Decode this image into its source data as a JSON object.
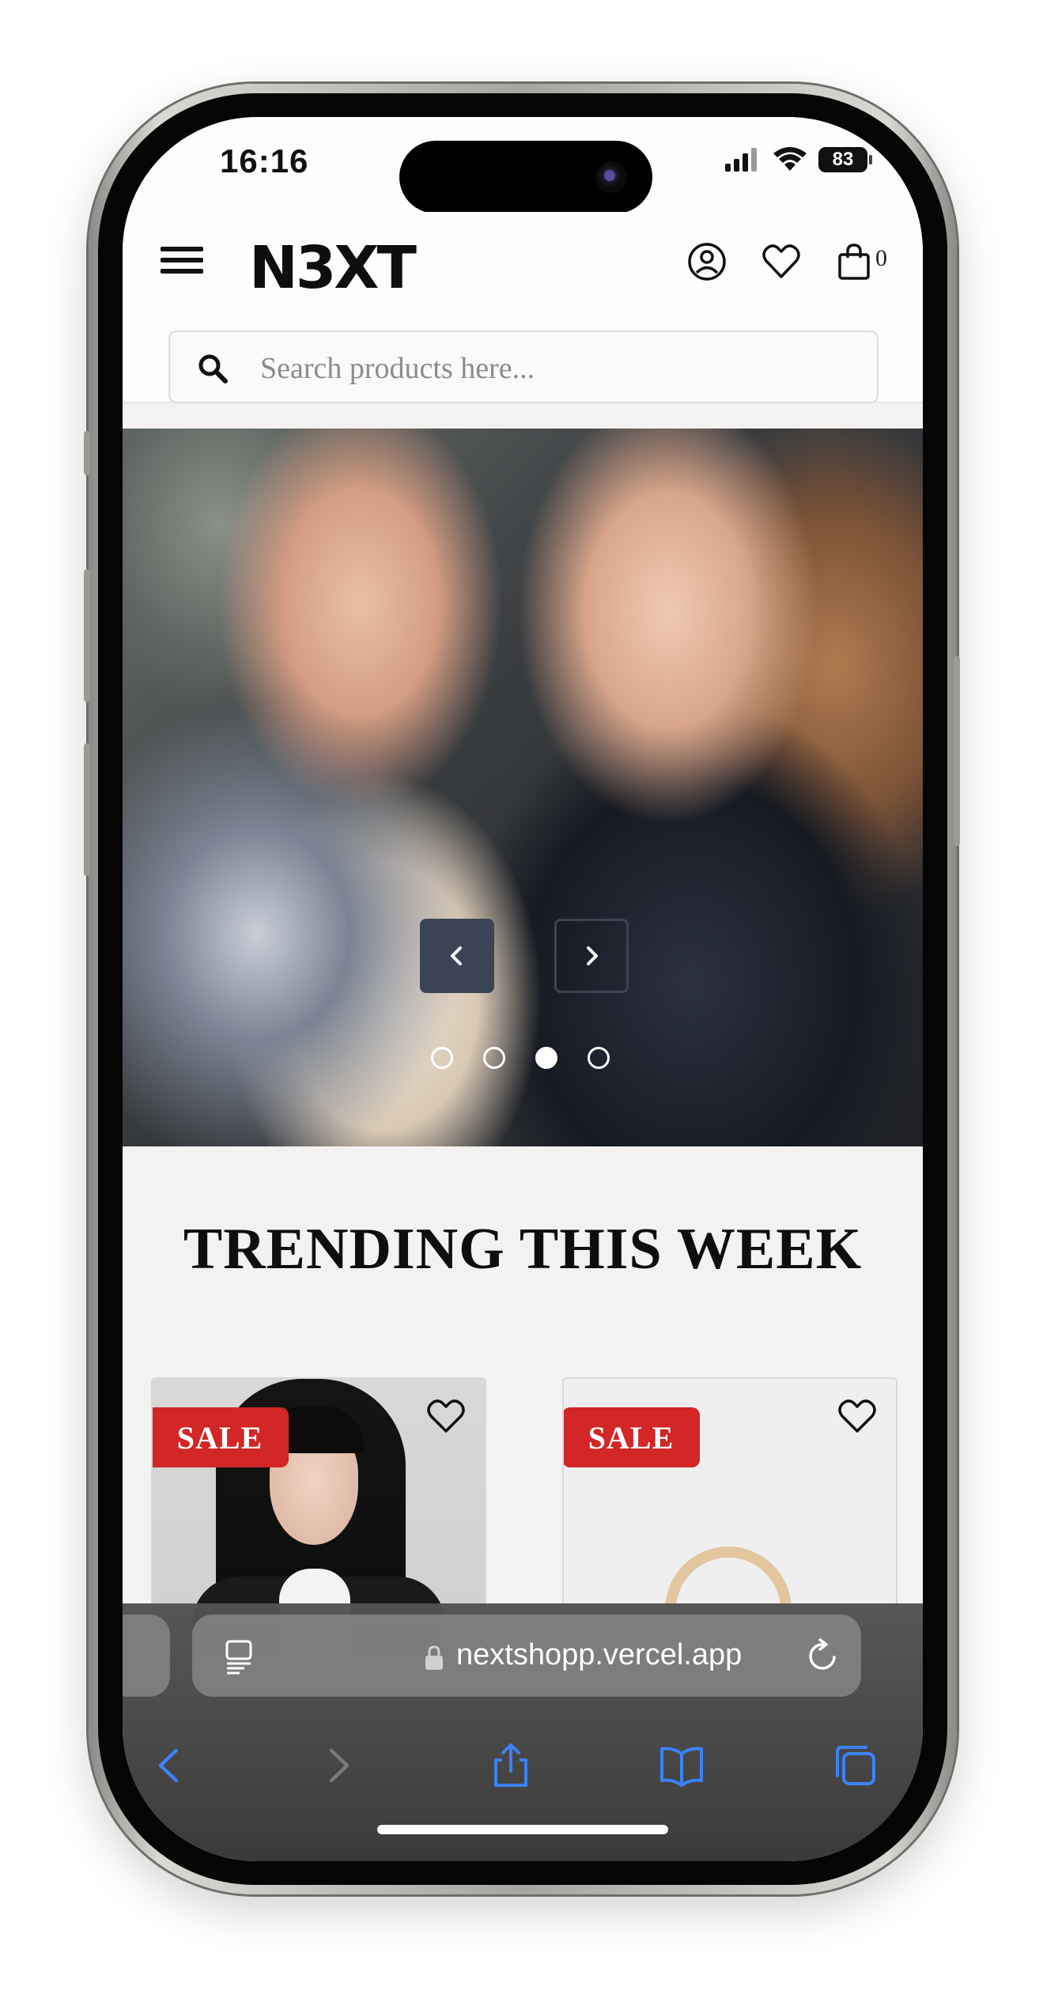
{
  "status_bar": {
    "time": "16:16",
    "battery": "83"
  },
  "header": {
    "logo": "N3XT",
    "cart_count": "0"
  },
  "search": {
    "placeholder": "Search products here..."
  },
  "hero": {
    "slide_count": 4,
    "active_slide_index": 2
  },
  "trending": {
    "title": "TRENDING THIS WEEK",
    "products": [
      {
        "badge": "SALE"
      },
      {
        "badge": "SALE"
      }
    ]
  },
  "browser": {
    "url": "nextshopp.vercel.app"
  },
  "colors": {
    "sale_red": "#d32626",
    "accent_blue": "#3b82f6",
    "slider_button": "#3a4456"
  }
}
